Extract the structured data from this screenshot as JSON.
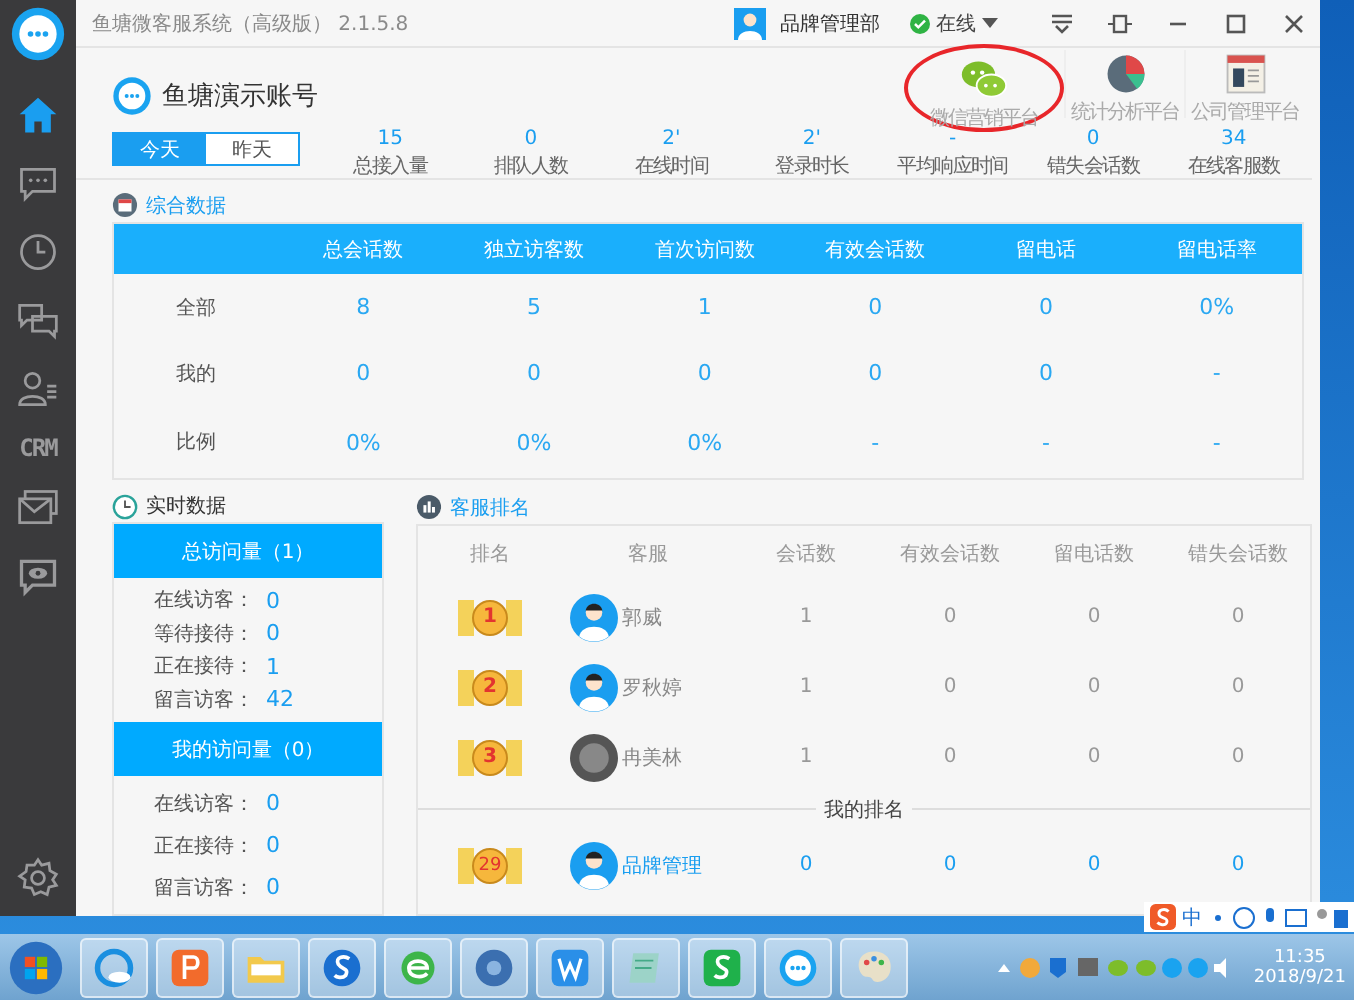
{
  "window": {
    "title": "鱼塘微客服系统（高级版） 2.1.5.8",
    "user": "品牌管理部",
    "status": "在线",
    "online": true
  },
  "sidebar": {
    "items": [
      {
        "kind": "home",
        "selected": true
      },
      {
        "kind": "chat",
        "selected": false
      },
      {
        "kind": "history",
        "selected": false
      },
      {
        "kind": "conversations",
        "selected": false
      },
      {
        "kind": "contacts",
        "selected": false
      },
      {
        "kind": "crm",
        "label": "CRM",
        "selected": false
      },
      {
        "kind": "mail",
        "selected": false
      },
      {
        "kind": "monitor",
        "selected": false
      },
      {
        "kind": "settings",
        "selected": false
      }
    ]
  },
  "account": {
    "name": "鱼塘演示账号"
  },
  "date_tabs": [
    {
      "label": "今天",
      "selected": true
    },
    {
      "label": "昨天",
      "selected": false
    }
  ],
  "stats": [
    {
      "value": "15",
      "label": "总接入量"
    },
    {
      "value": "0",
      "label": "排队人数"
    },
    {
      "value": "2'",
      "label": "在线时间"
    },
    {
      "value": "2'",
      "label": "登录时长"
    },
    {
      "value": "-",
      "label": "平均响应时间"
    },
    {
      "value": "0",
      "label": "错失会话数"
    },
    {
      "value": "34",
      "label": "在线客服数"
    }
  ],
  "platforms": [
    {
      "kind": "wechat",
      "label": "微信营销平台",
      "circled": true
    },
    {
      "kind": "stats",
      "label": "统计分析平台",
      "circled": false
    },
    {
      "kind": "company",
      "label": "公司管理平台",
      "circled": false
    }
  ],
  "overview": {
    "title": "综合数据",
    "columns": [
      "总会话数",
      "独立访客数",
      "首次访问数",
      "有效会话数",
      "留电话",
      "留电话率"
    ],
    "rows": [
      {
        "label": "全部",
        "cells": [
          "8",
          "5",
          "1",
          "0",
          "0",
          "0%"
        ]
      },
      {
        "label": "我的",
        "cells": [
          "0",
          "0",
          "0",
          "0",
          "0",
          "-"
        ]
      },
      {
        "label": "比例",
        "cells": [
          "0%",
          "0%",
          "0%",
          "-",
          "-",
          "-"
        ]
      }
    ]
  },
  "realtime": {
    "title": "实时数据",
    "groups": [
      {
        "title": "总访问量（1）",
        "items": [
          {
            "label": "在线访客：",
            "value": "0"
          },
          {
            "label": "等待接待：",
            "value": "0"
          },
          {
            "label": "正在接待：",
            "value": "1"
          },
          {
            "label": "留言访客：",
            "value": "42"
          }
        ]
      },
      {
        "title": "我的访问量（0）",
        "items": [
          {
            "label": "在线访客：",
            "value": "0"
          },
          {
            "label": "正在接待：",
            "value": "0"
          },
          {
            "label": "留言访客：",
            "value": "0"
          }
        ]
      }
    ]
  },
  "ranking": {
    "title": "客服排名",
    "columns": [
      "排名",
      "客服",
      "会话数",
      "有效会话数",
      "留电话数",
      "错失会话数"
    ],
    "rows": [
      {
        "kind": "silhouette",
        "cells": [
          "1",
          "郭威",
          "1",
          "0",
          "0",
          "0"
        ]
      },
      {
        "kind": "silhouette",
        "cells": [
          "2",
          "罗秋婷",
          "1",
          "0",
          "0",
          "0"
        ]
      },
      {
        "kind": "photo",
        "cells": [
          "3",
          "冉美林",
          "1",
          "0",
          "0",
          "0"
        ]
      }
    ],
    "mine_label": "我的排名",
    "mine": {
      "kind": "silhouette",
      "cells": [
        "29",
        "品牌管理",
        "0",
        "0",
        "0",
        "0"
      ]
    }
  },
  "ime": {
    "label": "中"
  },
  "taskbar": {
    "apps": [
      {
        "kind": "browser"
      },
      {
        "kind": "presentation"
      },
      {
        "kind": "folder"
      },
      {
        "kind": "search"
      },
      {
        "kind": "ie"
      },
      {
        "kind": "disc"
      },
      {
        "kind": "writer"
      },
      {
        "kind": "notepad"
      },
      {
        "kind": "sheet"
      },
      {
        "kind": "chat"
      },
      {
        "kind": "paint"
      }
    ],
    "time": "11:35",
    "date": "2018/9/21"
  }
}
